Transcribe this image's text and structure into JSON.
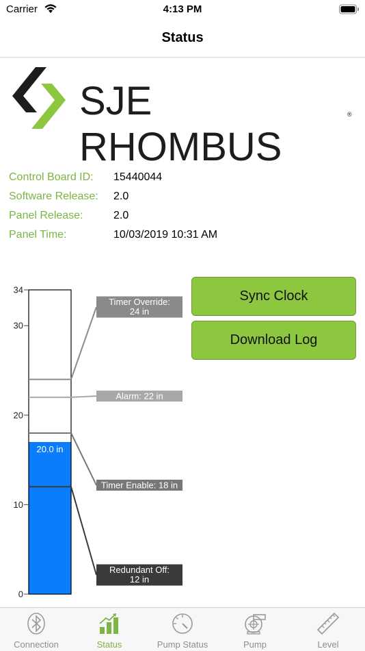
{
  "status_bar": {
    "carrier": "Carrier",
    "time": "4:13 PM"
  },
  "nav": {
    "title": "Status"
  },
  "logo": {
    "text": "SJE RHOMBUS",
    "registered_mark": "®",
    "colors": {
      "dark": "#1d1d1d",
      "green": "#8dc63f"
    }
  },
  "info": {
    "rows": [
      {
        "label": "Control Board ID:",
        "value": "15440044"
      },
      {
        "label": "Software Release:",
        "value": "2.0"
      },
      {
        "label": "Panel Release:",
        "value": "2.0"
      },
      {
        "label": "Panel Time:",
        "value": "10/03/2019 10:31 AM"
      }
    ],
    "label_color": "#7cb541"
  },
  "gauge": {
    "axis_max": 34,
    "ticks": [
      0,
      10,
      20,
      30,
      34
    ],
    "level_value": 17.0,
    "level_label": "20.0 in",
    "level_color": "#0a7cfc",
    "setpoints": [
      {
        "label_lines": [
          "Timer Override:",
          "24 in"
        ],
        "value": 24,
        "color": "#8a8a8a"
      },
      {
        "label_lines": [
          "Alarm: 22 in"
        ],
        "value": 22,
        "color": "#a8a8a8"
      },
      {
        "label_lines": [
          "Timer Enable: 18 in"
        ],
        "value": 18,
        "color": "#777777"
      },
      {
        "label_lines": [
          "Redundant Off:",
          "12 in"
        ],
        "value": 12,
        "color": "#3a3a3a"
      }
    ]
  },
  "buttons": {
    "sync_clock": "Sync Clock",
    "download_log": "Download Log"
  },
  "tabs": [
    {
      "label": "Connection",
      "icon": "bluetooth-icon",
      "active": false
    },
    {
      "label": "Status",
      "icon": "bar-chart-icon",
      "active": true
    },
    {
      "label": "Pump Status",
      "icon": "gauge-icon",
      "active": false
    },
    {
      "label": "Pump",
      "icon": "pump-icon",
      "active": false
    },
    {
      "label": "Level",
      "icon": "ruler-icon",
      "active": false
    }
  ],
  "accent_color": "#8dc63f"
}
